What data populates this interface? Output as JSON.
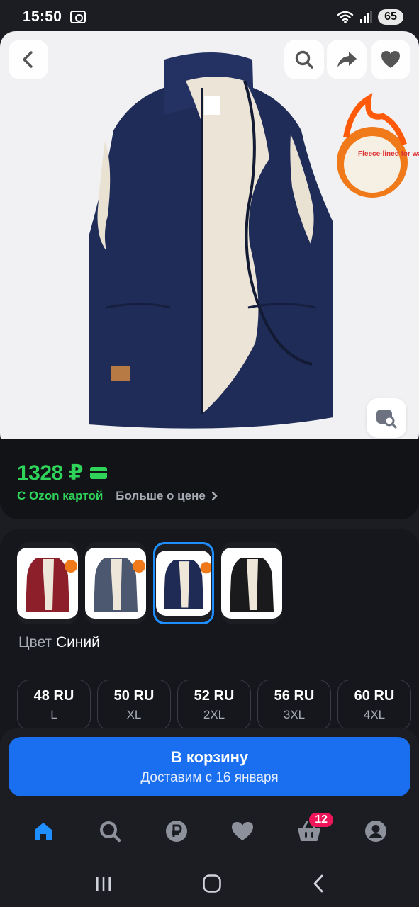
{
  "status_bar": {
    "time": "15:50",
    "battery": "65"
  },
  "hero": {
    "badge_text": "Fleece-lined for warmth"
  },
  "price": {
    "amount": "1328 ₽",
    "ozon_card": "С Ozon картой",
    "more_price": "Больше о цене"
  },
  "variants": {
    "color_label": "Цвет",
    "color_value": "Синий",
    "thumbs": [
      {
        "color": "#8c1f2a",
        "selected": false
      },
      {
        "color": "#4c5870",
        "selected": false
      },
      {
        "color": "#1f2a55",
        "selected": true
      },
      {
        "color": "#1a1a1c",
        "selected": false
      }
    ]
  },
  "sizes": [
    {
      "ru": "48 RU",
      "intl": "L"
    },
    {
      "ru": "50 RU",
      "intl": "XL"
    },
    {
      "ru": "52 RU",
      "intl": "2XL"
    },
    {
      "ru": "56 RU",
      "intl": "3XL"
    },
    {
      "ru": "60 RU",
      "intl": "4XL"
    }
  ],
  "cart": {
    "label": "В корзину",
    "delivery": "Доставим с 16 января"
  },
  "tabbar": {
    "cart_badge": "12"
  },
  "colors": {
    "accent": "#1a6ff0",
    "price_green": "#30d35a",
    "badge_pink": "#f0145a"
  }
}
